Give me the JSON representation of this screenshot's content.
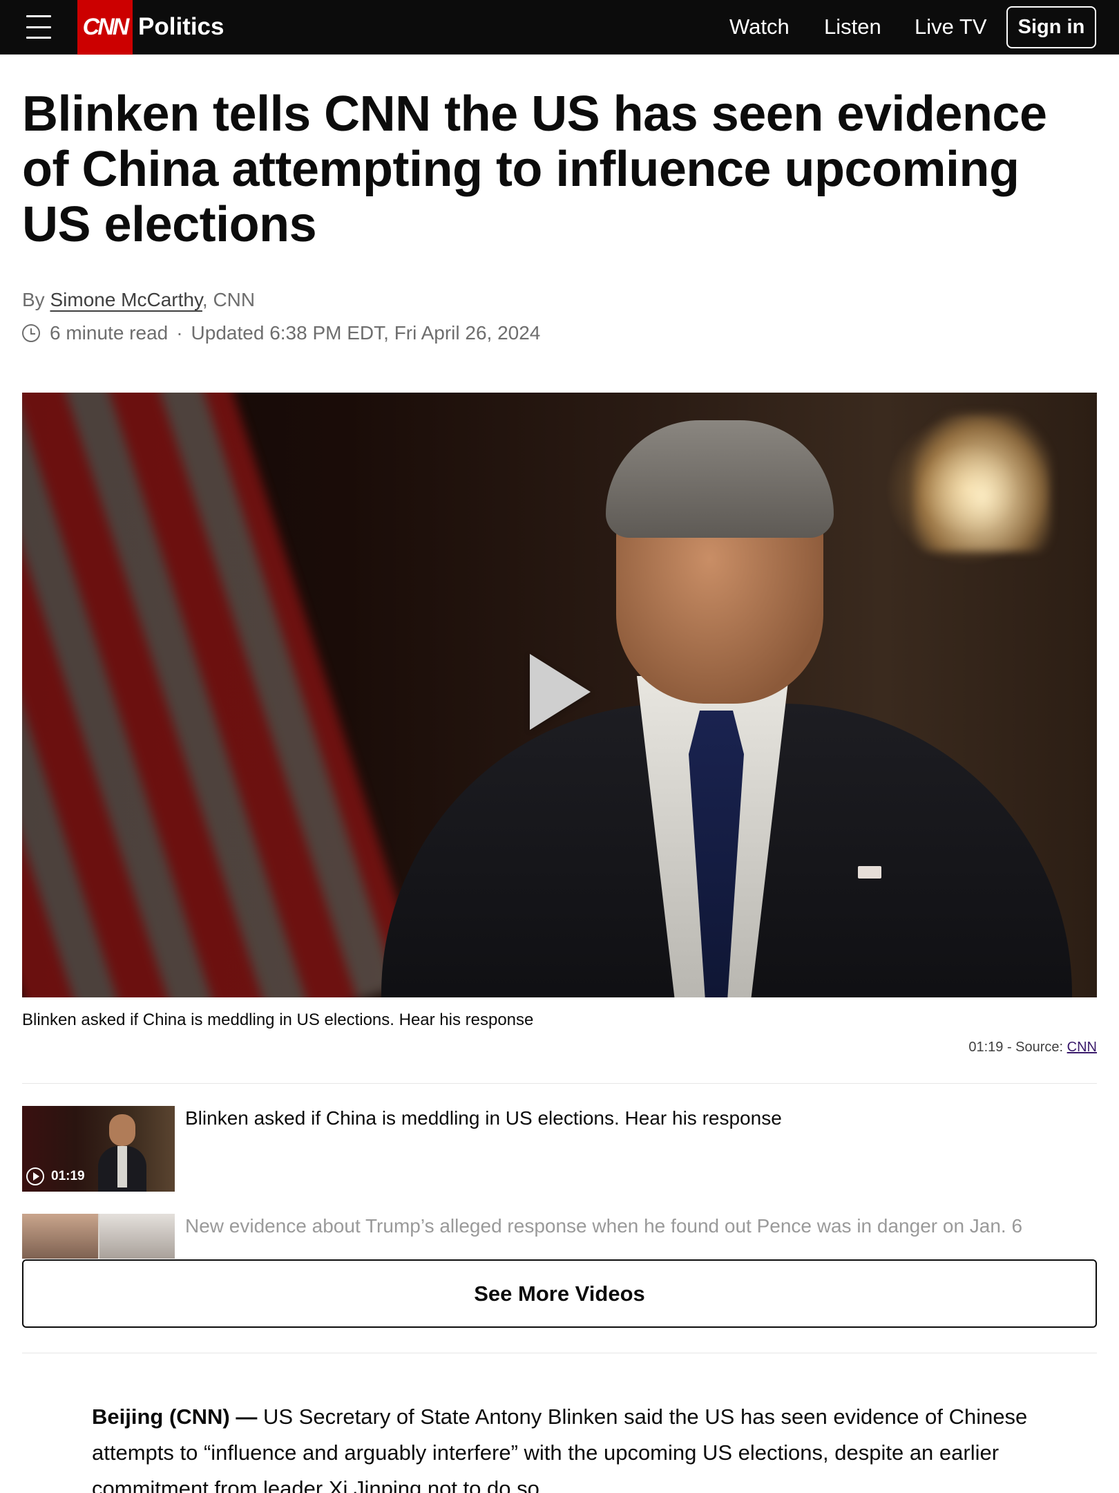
{
  "header": {
    "logo_text": "CNN",
    "section": "Politics",
    "nav": [
      "Watch",
      "Listen",
      "Live TV"
    ],
    "sign_in": "Sign in"
  },
  "article": {
    "headline": "Blinken tells CNN the US has seen evidence of China attempting to influence upcoming US elections",
    "by_prefix": "By ",
    "author": "Simone McCarthy",
    "outlet": ", CNN",
    "read_time": "6 minute read",
    "separator": "·",
    "updated": "Updated 6:38 PM EDT, Fri April 26, 2024",
    "dateline": "Beijing (CNN) —",
    "body_lead": " US Secretary of State Antony Blinken said the US has seen evidence of Chinese attempts to “influence and arguably interfere” with the upcoming US elections, despite an earlier commitment from leader Xi Jinping not to do so."
  },
  "video": {
    "caption": "Blinken asked if China is meddling in US elections. Hear his response",
    "duration_source": "01:19 - Source: ",
    "source_link": "CNN"
  },
  "playlist": [
    {
      "title": "Blinken asked if China is meddling in US elections. Hear his response",
      "duration": "01:19"
    },
    {
      "title": "New evidence about Trump’s alleged response when he found out Pence was in danger on Jan. 6"
    }
  ],
  "see_more": "See More Videos",
  "colors": {
    "brand_red": "#cc0000",
    "header_bg": "#0c0c0c"
  }
}
